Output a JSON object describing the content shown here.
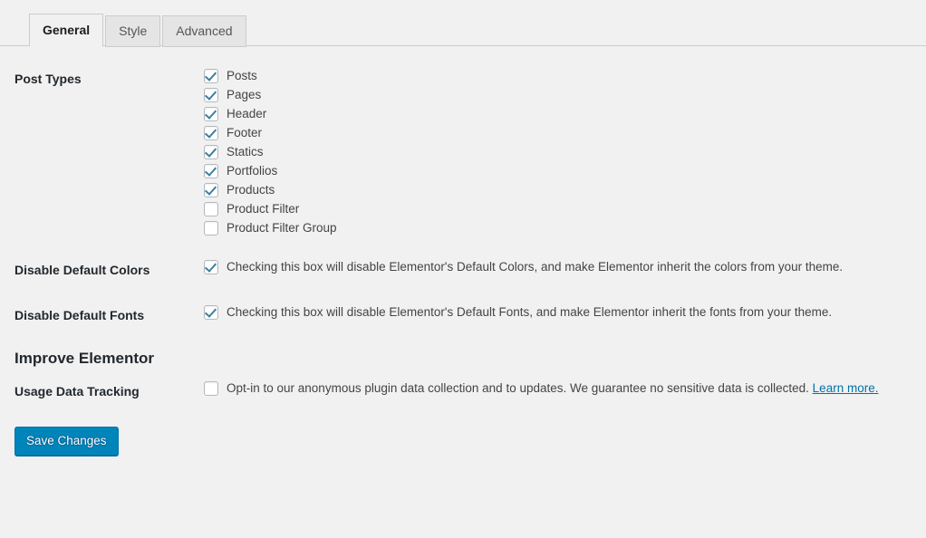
{
  "tabs": [
    {
      "id": "general",
      "label": "General",
      "active": true
    },
    {
      "id": "style",
      "label": "Style",
      "active": false
    },
    {
      "id": "advanced",
      "label": "Advanced",
      "active": false
    }
  ],
  "sections": {
    "post_types": {
      "label": "Post Types",
      "items": [
        {
          "label": "Posts",
          "checked": true
        },
        {
          "label": "Pages",
          "checked": true
        },
        {
          "label": "Header",
          "checked": true
        },
        {
          "label": "Footer",
          "checked": true
        },
        {
          "label": "Statics",
          "checked": true
        },
        {
          "label": "Portfolios",
          "checked": true
        },
        {
          "label": "Products",
          "checked": true
        },
        {
          "label": "Product Filter",
          "checked": false
        },
        {
          "label": "Product Filter Group",
          "checked": false
        }
      ]
    },
    "disable_default_colors": {
      "label": "Disable Default Colors",
      "checked": true,
      "description": "Checking this box will disable Elementor's Default Colors, and make Elementor inherit the colors from your theme."
    },
    "disable_default_fonts": {
      "label": "Disable Default Fonts",
      "checked": true,
      "description": "Checking this box will disable Elementor's Default Fonts, and make Elementor inherit the fonts from your theme."
    },
    "improve_elementor": {
      "heading": "Improve Elementor"
    },
    "usage_data_tracking": {
      "label": "Usage Data Tracking",
      "checked": false,
      "description": "Opt-in to our anonymous plugin data collection and to updates. We guarantee no sensitive data is collected.",
      "link_text": "Learn more."
    }
  },
  "actions": {
    "save_label": "Save Changes"
  },
  "colors": {
    "page_background": "#f1f1f1",
    "primary_button": "#0085ba",
    "primary_button_border": "#0073aa",
    "link": "#0073aa",
    "checkmark": "#3d7fa0",
    "tab_inactive_background": "#e5e5e5",
    "border": "#cccccc",
    "text": "#444444",
    "heading_text": "#23282d"
  }
}
